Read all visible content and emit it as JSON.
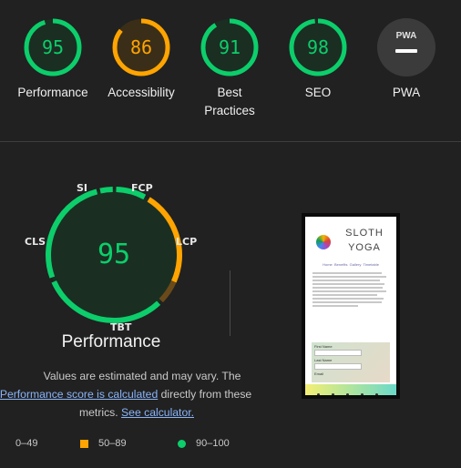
{
  "categories": [
    {
      "score": "95",
      "label": "Performance",
      "value": 0.95,
      "color": "#0cce6b",
      "bg": "#1b2e22"
    },
    {
      "score": "86",
      "label": "Accessibility",
      "value": 0.86,
      "color": "#ffa400",
      "bg": "#3a2e18"
    },
    {
      "score": "91",
      "label": "Best Practices",
      "value": 0.91,
      "color": "#0cce6b",
      "bg": "#1b2e22"
    },
    {
      "score": "98",
      "label": "SEO",
      "value": 0.98,
      "color": "#0cce6b",
      "bg": "#1b2e22"
    },
    {
      "label": "PWA",
      "badge": "PWA"
    }
  ],
  "main": {
    "score": "95",
    "title": "Performance",
    "metrics": [
      "SI",
      "FCP",
      "LCP",
      "TBT",
      "CLS"
    ],
    "note_line1": "Values are estimated and may vary. The",
    "note_link1": "Performance score is calculated",
    "note_line2_rest": " directly from these",
    "note_line3_pre": "metrics. ",
    "note_link2": "See calculator."
  },
  "legend": [
    {
      "range": "0–49",
      "color": "#ff4e42",
      "shape": "triangle"
    },
    {
      "range": "50–89",
      "color": "#ffa400",
      "shape": "square"
    },
    {
      "range": "90–100",
      "color": "#0cce6b",
      "shape": "circle"
    }
  ],
  "screenshot": {
    "title_line1": "SLOTH",
    "title_line2": "YOGA",
    "nav": [
      "Home",
      "Benefits",
      "Gallery",
      "Timetable"
    ],
    "form_labels": [
      "First Name",
      "Last Name",
      "Email"
    ]
  }
}
